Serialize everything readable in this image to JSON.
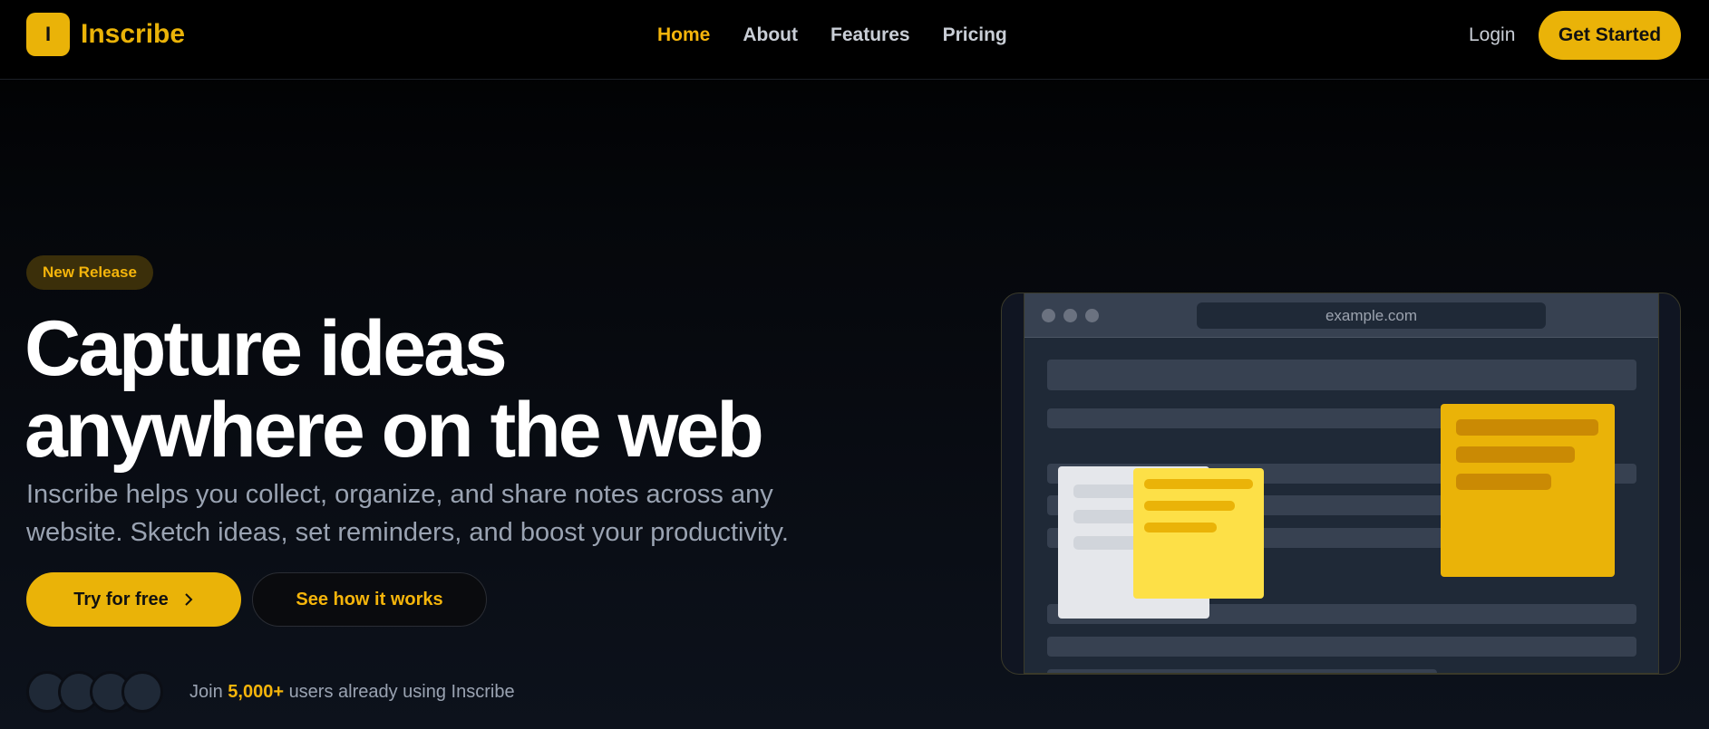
{
  "brand": {
    "mark": "I",
    "name": "Inscribe"
  },
  "nav": {
    "links": [
      {
        "label": "Home",
        "active": true
      },
      {
        "label": "About",
        "active": false
      },
      {
        "label": "Features",
        "active": false
      },
      {
        "label": "Pricing",
        "active": false
      }
    ],
    "login": "Login",
    "cta": "Get Started"
  },
  "hero": {
    "badge": "New Release",
    "headline_line1": "Capture ideas",
    "headline_line2": "anywhere on the web",
    "subtitle": "Inscribe helps you collect, organize, and share notes across any website. Sketch ideas, set reminders, and boost your productivity.",
    "primary_button": "Try for free",
    "secondary_button": "See how it works",
    "social_prefix": "Join",
    "social_count": "5,000+",
    "social_suffix": "users already using Inscribe"
  },
  "illustration": {
    "url": "example.com"
  },
  "colors": {
    "accent": "#eab308",
    "accent_text": "#f5b50b",
    "background": "#000000",
    "muted_text": "#9aa3b2"
  },
  "icons": [
    "chevron-right-icon"
  ]
}
